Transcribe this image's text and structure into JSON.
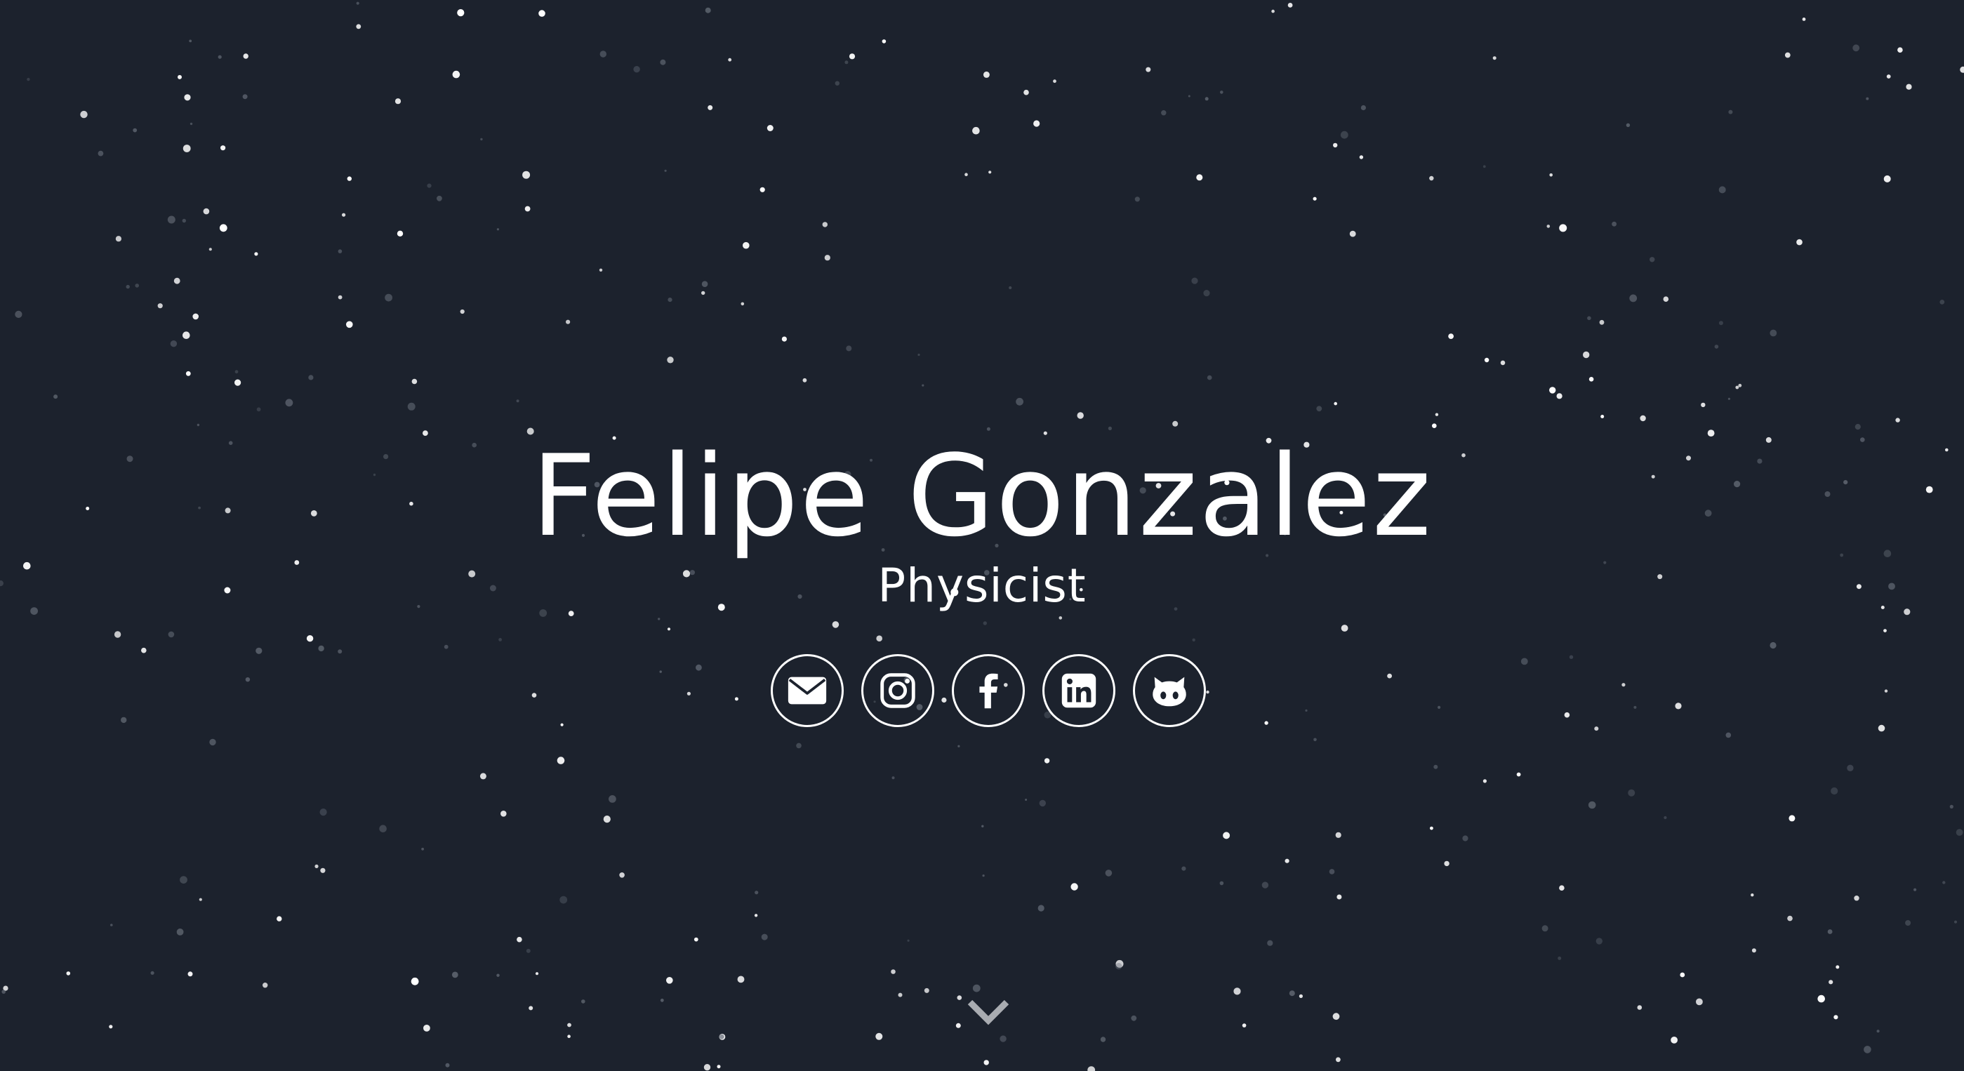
{
  "hero": {
    "name": "Felipe Gonzalez",
    "role": "Physicist"
  },
  "social": [
    {
      "icon": "envelope-icon",
      "label": "Email"
    },
    {
      "icon": "instagram-icon",
      "label": "Instagram"
    },
    {
      "icon": "facebook-icon",
      "label": "Facebook"
    },
    {
      "icon": "linkedin-icon",
      "label": "LinkedIn"
    },
    {
      "icon": "github-icon",
      "label": "GitHub"
    }
  ],
  "scroll": {
    "icon": "chevron-down-icon"
  },
  "colors": {
    "background": "#1c222d",
    "text": "#ffffff",
    "star_bright": "#ffffff",
    "star_dim": "#6a717c",
    "chevron": "#a9acb1"
  }
}
